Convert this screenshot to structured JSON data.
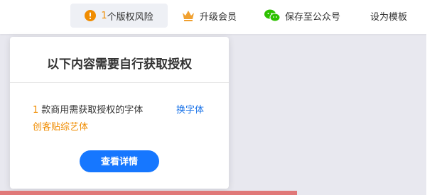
{
  "topbar": {
    "copyright_risk": {
      "count": "1",
      "label": "个版权风险",
      "icon": "warning-icon"
    },
    "upgrade": {
      "label": "升级会员",
      "icon": "crown-icon"
    },
    "save_to_wechat": {
      "label": "保存至公众号",
      "icon": "wechat-icon"
    },
    "set_template": {
      "label": "设为模板"
    }
  },
  "popover": {
    "title": "以下内容需要自行获取授权",
    "item_count": "1",
    "item_text": "款商用需获取授权的字体",
    "change_font_label": "换字体",
    "font_name": "创客贴综艺体",
    "details_button": "查看详情"
  },
  "colors": {
    "accent_orange": "#f08c00",
    "link_blue": "#1a73e8",
    "primary_button": "#1677ff",
    "crown": "#f0a030",
    "wechat_green": "#2dc100"
  }
}
